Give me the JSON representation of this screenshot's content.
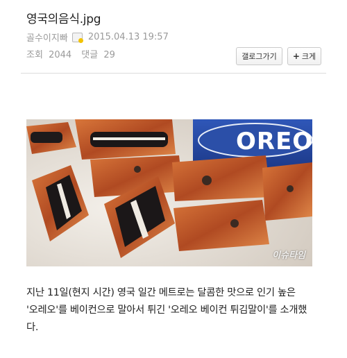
{
  "post": {
    "title": "영국의음식.jpg",
    "author": "골수이지빠",
    "date": "2015.04.13 19:57",
    "views_label": "조회",
    "views": "2044",
    "comments_label": "댓글",
    "comments": "29"
  },
  "buttons": {
    "gallery": "갤로그가기",
    "zoom_icon": "+",
    "zoom": "크게"
  },
  "image": {
    "brand_text": "OREO",
    "watermark": "이슈타임"
  },
  "body": {
    "line1": "지난 11일(현지 시간) 영국 일간 메트로는 달콤한 맛으로 인기 높은",
    "line2": "'오레오'를 베이컨으로 말아서 튀긴 '오레오 베이컨 튀김말이'를 소개했",
    "line3": "다."
  }
}
